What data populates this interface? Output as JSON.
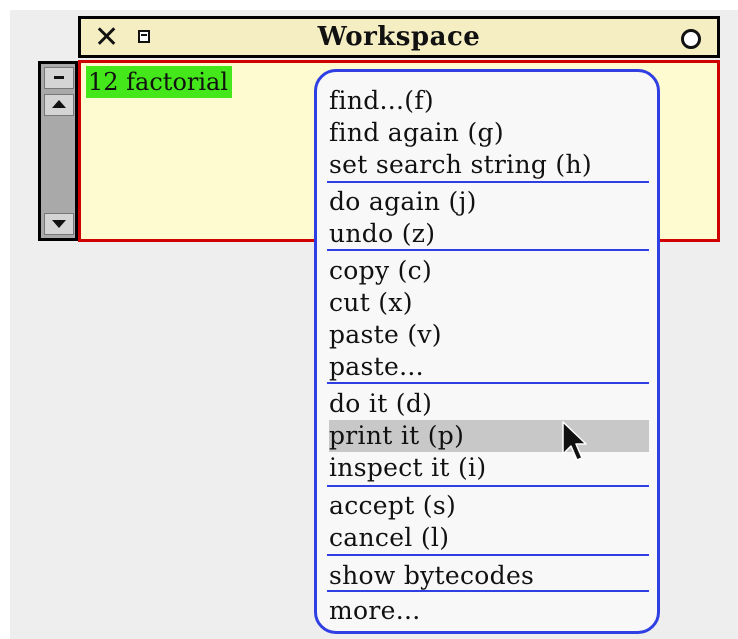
{
  "window": {
    "title": "Workspace",
    "close_icon": "close-icon",
    "collapse_icon": "collapse-icon",
    "expand_icon": "expand-icon",
    "content_text": "12 factorial"
  },
  "scrollbar": {
    "menu_icon": "scroll-menu-icon",
    "up_icon": "scroll-up-icon",
    "down_icon": "scroll-down-icon"
  },
  "menu": {
    "groups": [
      [
        "find...(f)",
        "find again (g)",
        "set search string (h)"
      ],
      [
        "do again (j)",
        "undo (z)"
      ],
      [
        "copy (c)",
        "cut (x)",
        "paste (v)",
        "paste..."
      ],
      [
        "do it (d)",
        "print it (p)",
        "inspect it (i)"
      ],
      [
        "accept (s)",
        "cancel (l)"
      ],
      [
        "show bytecodes"
      ],
      [
        "more..."
      ]
    ],
    "highlighted_item": "print it (p)"
  },
  "colors": {
    "menu_border": "#2f3fe3",
    "pane_border": "#d10000",
    "pane_background": "#fffbd0",
    "selection": "#44e81a",
    "titlebar": "#f5eec2"
  }
}
